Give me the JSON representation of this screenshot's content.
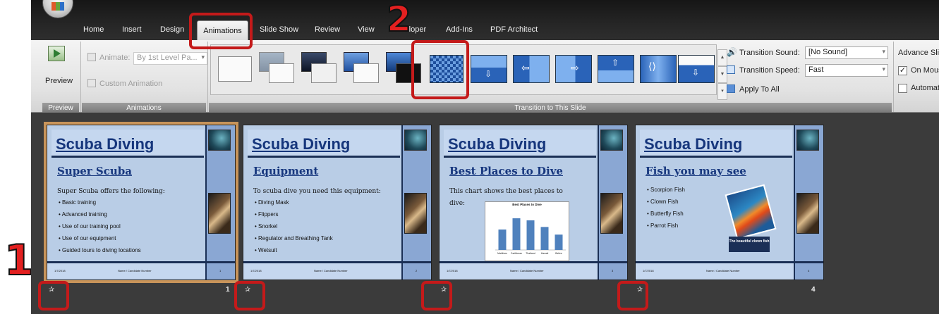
{
  "tabs": [
    "Home",
    "Insert",
    "Design",
    "Animations",
    "Slide Show",
    "Review",
    "View",
    "Developer",
    "Add-Ins",
    "PDF Architect"
  ],
  "ribbon": {
    "preview_label": "Preview",
    "preview_group": "Preview",
    "animate_label": "Animate:",
    "animate_value": "By 1st Level Pa...",
    "custom_animation": "Custom Animation",
    "animations_group": "Animations",
    "transition_group": "Transition to This Slide",
    "sound_label": "Transition Sound:",
    "sound_value": "[No Sound]",
    "speed_label": "Transition Speed:",
    "speed_value": "Fast",
    "apply_all": "Apply To All",
    "advance_label": "Advance Slide",
    "on_mouse": "On Mouse C",
    "automatically": "Automatical",
    "on_mouse_checked": true,
    "automatically_checked": false
  },
  "slides": [
    {
      "title": "Scuba Diving",
      "heading": "Super Scuba",
      "body": "Super Scuba offers the following:",
      "bullets": [
        "Basic training",
        "Advanced training",
        "Use of our training pool",
        "Use of our equipment",
        "Guided tours to diving locations"
      ],
      "date": "1/7/2018",
      "footer": "Name / Candidate Number",
      "num": "1",
      "page": "1",
      "selected": true
    },
    {
      "title": "Scuba Diving",
      "heading": "Equipment",
      "body": "To scuba dive you need this equipment:",
      "bullets": [
        "Diving Mask",
        "Flippers",
        "Snorkel",
        "Regulator and Breathing Tank",
        "Wetsuit"
      ],
      "date": "1/7/2018",
      "footer": "Name / Candidate Number",
      "num": "2",
      "page": "",
      "selected": false
    },
    {
      "title": "Scuba Diving",
      "heading": "Best Places to Dive",
      "body": "This chart shows the best places to dive:",
      "chart_title": "Best Places to Dive",
      "date": "1/7/2018",
      "footer": "Name / Candidate Number",
      "num": "3",
      "page": "",
      "selected": false
    },
    {
      "title": "Scuba Diving",
      "heading": "Fish you may see",
      "bullets": [
        "Scorpion Fish",
        "Clown Fish",
        "Butterfly Fish",
        "Parrot Fish"
      ],
      "caption": "The beautiful clown fish",
      "date": "1/7/2018",
      "footer": "Name / Candidate Number",
      "num": "4",
      "page": "4",
      "selected": false
    }
  ],
  "chart_data": {
    "type": "bar",
    "title": "Best Places to Dive",
    "categories": [
      "Maldives",
      "Caribbean",
      "Thailand",
      "Hawaii",
      "Belize"
    ],
    "values": [
      40,
      62,
      58,
      45,
      30
    ],
    "ylim": [
      0,
      80
    ]
  },
  "annotations": {
    "step1": "1",
    "step2": "2"
  },
  "colors": {
    "highlight": "#c41a1a",
    "title_blue": "#16367c",
    "slide_bg": "#b9cde6",
    "selected_border": "#c8945a"
  }
}
